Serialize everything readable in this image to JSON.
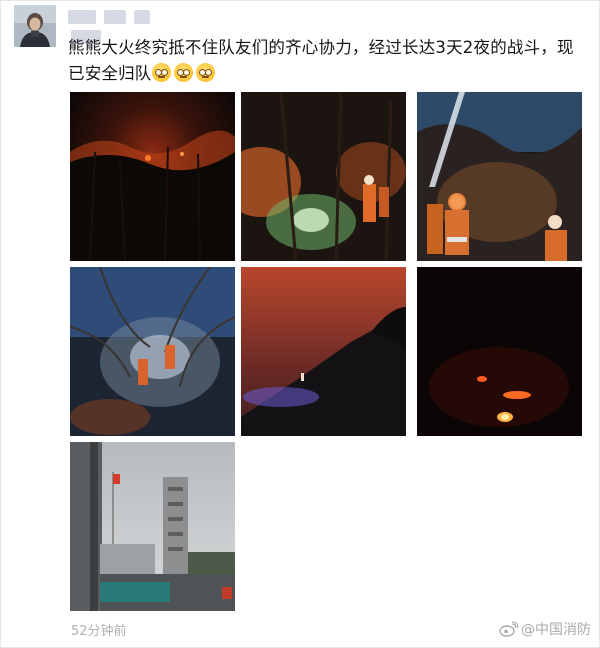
{
  "post": {
    "username_blurred": "",
    "text": "熊熊大火终究抵不住队友们的齐心协力，经过长达3天2夜的战斗，现已安全归队",
    "emojis": [
      "grimace-emoji",
      "grimace-emoji",
      "grimace-emoji"
    ],
    "timestamp": "52分钟前"
  },
  "photos": [
    {
      "label": "forest-fire-night-1"
    },
    {
      "label": "firefighters-headlamp-forest"
    },
    {
      "label": "firefighters-water-hose"
    },
    {
      "label": "firefighter-in-tree-night"
    },
    {
      "label": "red-sky-hillside-fire"
    },
    {
      "label": "distant-fire-dark-night"
    },
    {
      "label": "fire-station-tower-building"
    }
  ],
  "watermark": {
    "icon": "weibo-icon",
    "text": "@中国消防"
  }
}
